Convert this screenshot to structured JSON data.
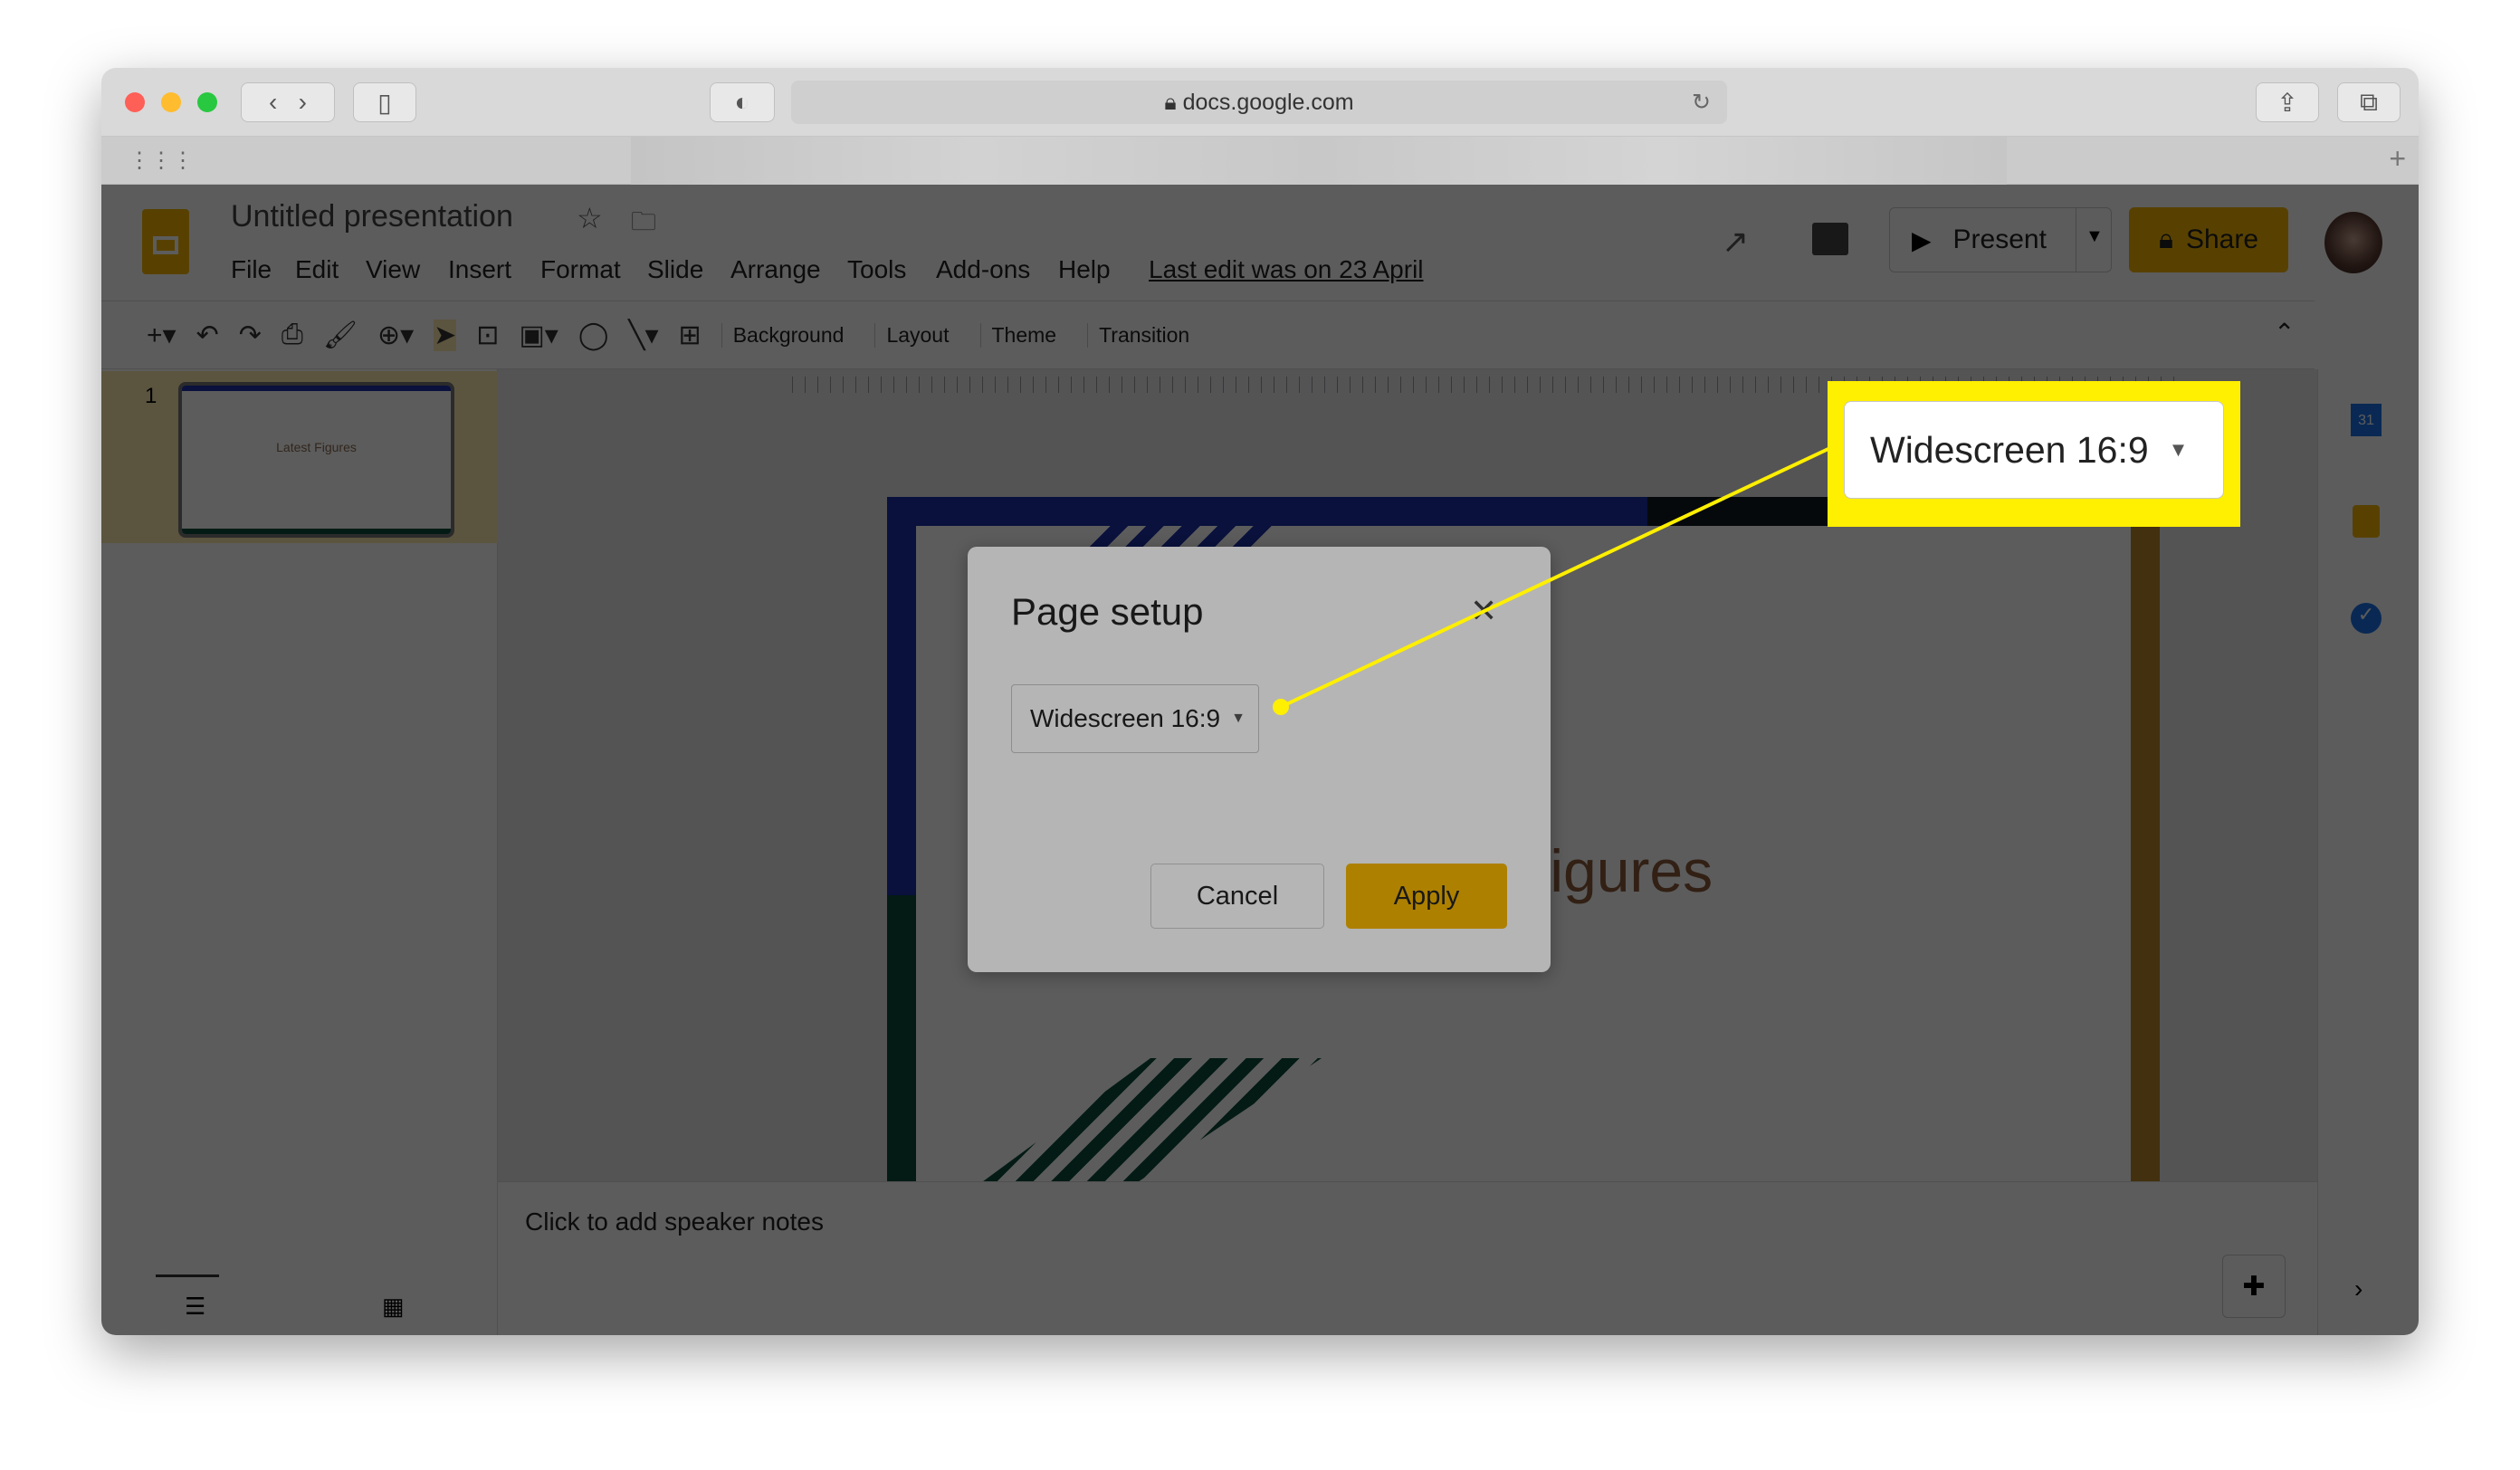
{
  "browser": {
    "url": "docs.google.com"
  },
  "app": {
    "title": "Untitled presentation",
    "menu": [
      "File",
      "Edit",
      "View",
      "Insert",
      "Format",
      "Slide",
      "Arrange",
      "Tools",
      "Add-ons",
      "Help"
    ],
    "last_edit": "Last edit was on 23 April",
    "present_label": "Present",
    "share_label": "Share",
    "toolbar": {
      "background": "Background",
      "layout": "Layout",
      "theme": "Theme",
      "transition": "Transition"
    },
    "slide_number": "1",
    "slide_title": "Latest Figures",
    "speaker_notes_placeholder": "Click to add speaker notes",
    "calendar_day": "31"
  },
  "dialog": {
    "title": "Page setup",
    "selected_size": "Widescreen 16:9",
    "cancel": "Cancel",
    "apply": "Apply"
  },
  "callout": {
    "selected_size": "Widescreen 16:9",
    "color": "#ffef00"
  },
  "colors": {
    "share": "#f4b400",
    "slide_blue": "#1a2fa8",
    "slide_green": "#0b4a3a",
    "slide_gold": "#b8862a"
  }
}
